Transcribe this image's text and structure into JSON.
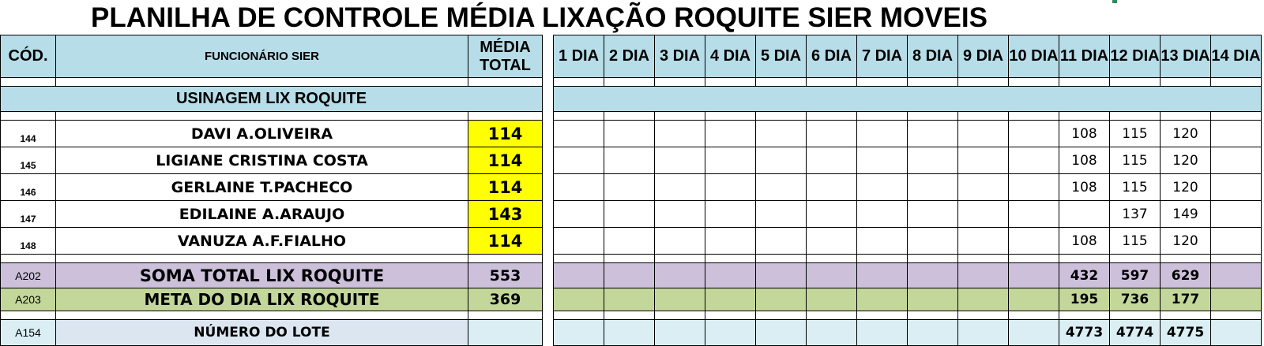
{
  "title": "PLANILHA DE CONTROLE MÉDIA LIXAÇÃO ROQUITE SIER MOVEIS",
  "header": {
    "cod": "CÓD.",
    "funcionario": "FUNCIONÁRIO SIER",
    "media_total": "MÉDIA TOTAL",
    "days": [
      "1 DIA",
      "2 DIA",
      "3 DIA",
      "4 DIA",
      "5 DIA",
      "6 DIA",
      "7 DIA",
      "8 DIA",
      "9 DIA",
      "10 DIA",
      "11 DIA",
      "12 DIA",
      "13 DIA",
      "14 DIA"
    ]
  },
  "section": {
    "label": "USINAGEM LIX ROQUITE"
  },
  "employees": [
    {
      "code": "144",
      "name": "DAVI A.OLIVEIRA",
      "avg": "114",
      "days": [
        "",
        "",
        "",
        "",
        "",
        "",
        "",
        "",
        "",
        "",
        "108",
        "115",
        "120",
        ""
      ]
    },
    {
      "code": "145",
      "name": "LIGIANE CRISTINA COSTA",
      "avg": "114",
      "days": [
        "",
        "",
        "",
        "",
        "",
        "",
        "",
        "",
        "",
        "",
        "108",
        "115",
        "120",
        ""
      ]
    },
    {
      "code": "146",
      "name": "GERLAINE T.PACHECO",
      "avg": "114",
      "days": [
        "",
        "",
        "",
        "",
        "",
        "",
        "",
        "",
        "",
        "",
        "108",
        "115",
        "120",
        ""
      ]
    },
    {
      "code": "147",
      "name": "EDILAINE A.ARAUJO",
      "avg": "143",
      "days": [
        "",
        "",
        "",
        "",
        "",
        "",
        "",
        "",
        "",
        "",
        "",
        "137",
        "149",
        ""
      ]
    },
    {
      "code": "148",
      "name": "VANUZA A.F.FIALHO",
      "avg": "114",
      "days": [
        "",
        "",
        "",
        "",
        "",
        "",
        "",
        "",
        "",
        "",
        "108",
        "115",
        "120",
        ""
      ]
    }
  ],
  "soma": {
    "code": "A202",
    "label": "SOMA TOTAL LIX ROQUITE",
    "avg": "553",
    "days": [
      "",
      "",
      "",
      "",
      "",
      "",
      "",
      "",
      "",
      "",
      "432",
      "597",
      "629",
      ""
    ]
  },
  "meta": {
    "code": "A203",
    "label": "META DO DIA LIX ROQUITE",
    "avg": "369",
    "days": [
      "",
      "",
      "",
      "",
      "",
      "",
      "",
      "",
      "",
      "",
      "195",
      "736",
      "177",
      ""
    ]
  },
  "lote": {
    "code": "A154",
    "label": "NÚMERO DO LOTE",
    "avg": "",
    "days": [
      "",
      "",
      "",
      "",
      "",
      "",
      "",
      "",
      "",
      "",
      "4773",
      "4774",
      "4775",
      ""
    ]
  }
}
